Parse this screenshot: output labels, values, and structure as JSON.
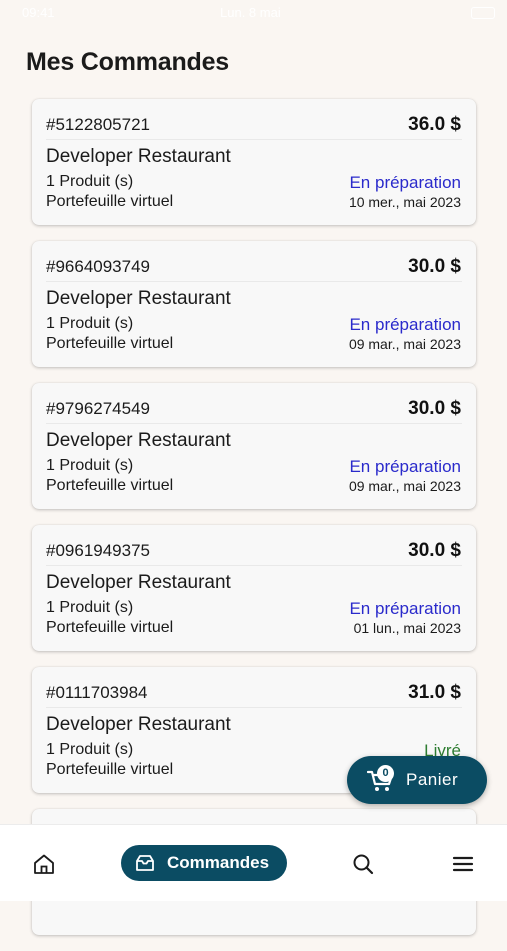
{
  "status_bar": {
    "time": "09:41",
    "carrier": "Lun. 8 mai"
  },
  "header": {
    "title": "Mes Commandes"
  },
  "orders": [
    {
      "id": "#5122805721",
      "amount": "36.0 $",
      "restaurant": "Developer Restaurant",
      "products": "1 Produit (s)",
      "payment": "Portefeuille virtuel",
      "status": "En préparation",
      "status_color": "#2a2acb",
      "date": "10 mer., mai 2023"
    },
    {
      "id": "#9664093749",
      "amount": "30.0 $",
      "restaurant": "Developer Restaurant",
      "products": "1 Produit (s)",
      "payment": "Portefeuille virtuel",
      "status": "En préparation",
      "status_color": "#2a2acb",
      "date": "09 mar., mai 2023"
    },
    {
      "id": "#9796274549",
      "amount": "30.0 $",
      "restaurant": "Developer Restaurant",
      "products": "1 Produit (s)",
      "payment": "Portefeuille virtuel",
      "status": "En préparation",
      "status_color": "#2a2acb",
      "date": "09 mar., mai 2023"
    },
    {
      "id": "#0961949375",
      "amount": "30.0 $",
      "restaurant": "Developer Restaurant",
      "products": "1 Produit (s)",
      "payment": "Portefeuille virtuel",
      "status": "En préparation",
      "status_color": "#2a2acb",
      "date": "01 lun., mai 2023"
    },
    {
      "id": "#0111703984",
      "amount": "31.0 $",
      "restaurant": "Developer Restaurant",
      "products": "1 Produit (s)",
      "payment": "Portefeuille virtuel",
      "status": "Livré",
      "status_color": "#2e7d32",
      "date": ""
    }
  ],
  "cart": {
    "count": "0",
    "label": "Panier",
    "icon": "cart-icon"
  },
  "bottom_nav": {
    "home_icon": "home-icon",
    "orders_label": "Commandes",
    "orders_icon": "inbox-icon",
    "search_icon": "search-icon",
    "menu_icon": "menu-icon"
  },
  "colors": {
    "accent": "#0b4c63",
    "background": "#faf6f2",
    "status_preparing": "#2a2acb",
    "status_delivered": "#2e7d32"
  }
}
